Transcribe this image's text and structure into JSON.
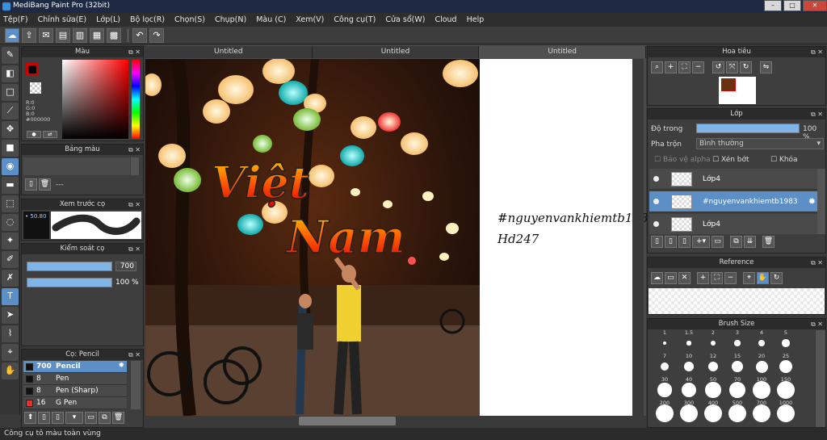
{
  "window": {
    "title": "MediBang Paint Pro (32bit)"
  },
  "menu": [
    "Tệp(F)",
    "Chỉnh sửa(E)",
    "Lớp(L)",
    "Bộ lọc(R)",
    "Chọn(S)",
    "Chụp(N)",
    "Màu (C)",
    "Xem(V)",
    "Công cụ(T)",
    "Cửa sổ(W)",
    "Cloud",
    "Help"
  ],
  "tabs": [
    "Untitled",
    "Untitled",
    "Untitled"
  ],
  "color_panel": {
    "title": "Màu",
    "r": "R:0",
    "g": "G:0",
    "b": "B:0",
    "hex": "#000000"
  },
  "palette_panel": {
    "title": "Bảng màu",
    "empty": "---"
  },
  "preview_panel": {
    "title": "Xem trước cọ",
    "value": "50.80"
  },
  "control_panel": {
    "title": "Kiểm soát cọ",
    "size": "700",
    "size_fill": 1.0,
    "opacity": "100 %",
    "opacity_fill": 1.0
  },
  "brush_panel": {
    "title": "Cọ: Pencil",
    "brushes": [
      {
        "size": "700",
        "name": "Pencil",
        "color": "#111111",
        "selected": true
      },
      {
        "size": "8",
        "name": "Pen",
        "color": "#111111",
        "selected": false
      },
      {
        "size": "8",
        "name": "Pen (Sharp)",
        "color": "#111111",
        "selected": false
      },
      {
        "size": "16",
        "name": "G Pen",
        "color": "#e53030",
        "selected": false
      }
    ]
  },
  "canvas_text": {
    "line1": "#nguyenvankhiemtb1983",
    "line2": "Hd247",
    "art1": "Việt",
    "art2": "Nam"
  },
  "navigator_panel": {
    "title": "Hoa tiêu"
  },
  "layer_panel": {
    "title": "Lớp",
    "opacity_label": "Độ trong",
    "opacity_value": "100 %",
    "opacity_fill": 1.0,
    "blend_label": "Pha trộn",
    "blend_value": "Bình thường",
    "protect_alpha": "Bảo vệ alpha",
    "clipping": "Xén bớt",
    "lock": "Khóa",
    "layers": [
      {
        "name": "Lớp4",
        "selected": false
      },
      {
        "name": "#nguyenvankhiemtb1983",
        "selected": true
      },
      {
        "name": "Lớp4",
        "selected": false
      }
    ]
  },
  "reference_panel": {
    "title": "Reference"
  },
  "brush_size_panel": {
    "title": "Brush Size",
    "sizes": [
      "1",
      "1.5",
      "2",
      "3",
      "4",
      "5",
      "7",
      "10",
      "12",
      "15",
      "20",
      "25",
      "30",
      "40",
      "50",
      "70",
      "100",
      "150",
      "200",
      "300",
      "400",
      "500",
      "700",
      "1000"
    ]
  },
  "status": {
    "text": "Công cụ tô màu toàn vùng"
  },
  "colors": {
    "accent": "#5d8fc7",
    "titlebar": "#1e2a44",
    "panel": "#3e3e3e"
  }
}
